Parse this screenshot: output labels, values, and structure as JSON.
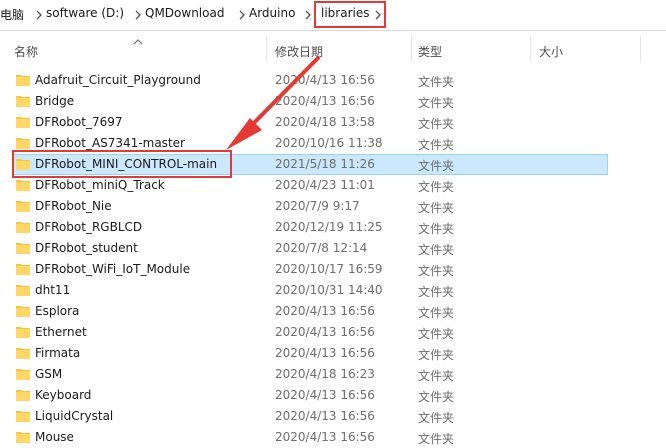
{
  "breadcrumb": [
    {
      "label": "电脑"
    },
    {
      "label": "software (D:)"
    },
    {
      "label": "QMDownload"
    },
    {
      "label": "Arduino"
    },
    {
      "label": "libraries"
    }
  ],
  "columns": {
    "name": "名称",
    "date": "修改日期",
    "type": "类型",
    "size": "大小"
  },
  "rows": [
    {
      "name": "Adafruit_Circuit_Playground",
      "date": "2020/4/13 16:56",
      "type": "文件夹"
    },
    {
      "name": "Bridge",
      "date": "2020/4/13 16:56",
      "type": "文件夹"
    },
    {
      "name": "DFRobot_7697",
      "date": "2020/4/18 13:58",
      "type": "文件夹"
    },
    {
      "name": "DFRobot_AS7341-master",
      "date": "2020/10/16 11:38",
      "type": "文件夹"
    },
    {
      "name": "DFRobot_MINI_CONTROL-main",
      "date": "2021/5/18 11:26",
      "type": "文件夹",
      "selected": true
    },
    {
      "name": "DFRobot_miniQ_Track",
      "date": "2020/4/23 11:01",
      "type": "文件夹"
    },
    {
      "name": "DFRobot_Nie",
      "date": "2020/7/9 9:17",
      "type": "文件夹"
    },
    {
      "name": "DFRobot_RGBLCD",
      "date": "2020/12/19 11:25",
      "type": "文件夹"
    },
    {
      "name": "DFRobot_student",
      "date": "2020/7/8 12:14",
      "type": "文件夹"
    },
    {
      "name": "DFRobot_WiFi_IoT_Module",
      "date": "2020/10/17 16:59",
      "type": "文件夹"
    },
    {
      "name": "dht11",
      "date": "2020/10/31 14:40",
      "type": "文件夹"
    },
    {
      "name": "Esplora",
      "date": "2020/4/13 16:56",
      "type": "文件夹"
    },
    {
      "name": "Ethernet",
      "date": "2020/4/13 16:56",
      "type": "文件夹"
    },
    {
      "name": "Firmata",
      "date": "2020/4/13 16:56",
      "type": "文件夹"
    },
    {
      "name": "GSM",
      "date": "2020/4/18 16:23",
      "type": "文件夹"
    },
    {
      "name": "Keyboard",
      "date": "2020/4/13 16:56",
      "type": "文件夹"
    },
    {
      "name": "LiquidCrystal",
      "date": "2020/4/13 16:56",
      "type": "文件夹"
    },
    {
      "name": "Mouse",
      "date": "2020/4/13 16:56",
      "type": "文件夹"
    }
  ],
  "colors": {
    "highlight": "#e53935",
    "selection": "#cce8ff",
    "folder": "#f5c542"
  },
  "icons": {
    "folder": "folder-icon",
    "chevron": "chevron-right-icon",
    "sort": "sort-ascending-icon"
  }
}
